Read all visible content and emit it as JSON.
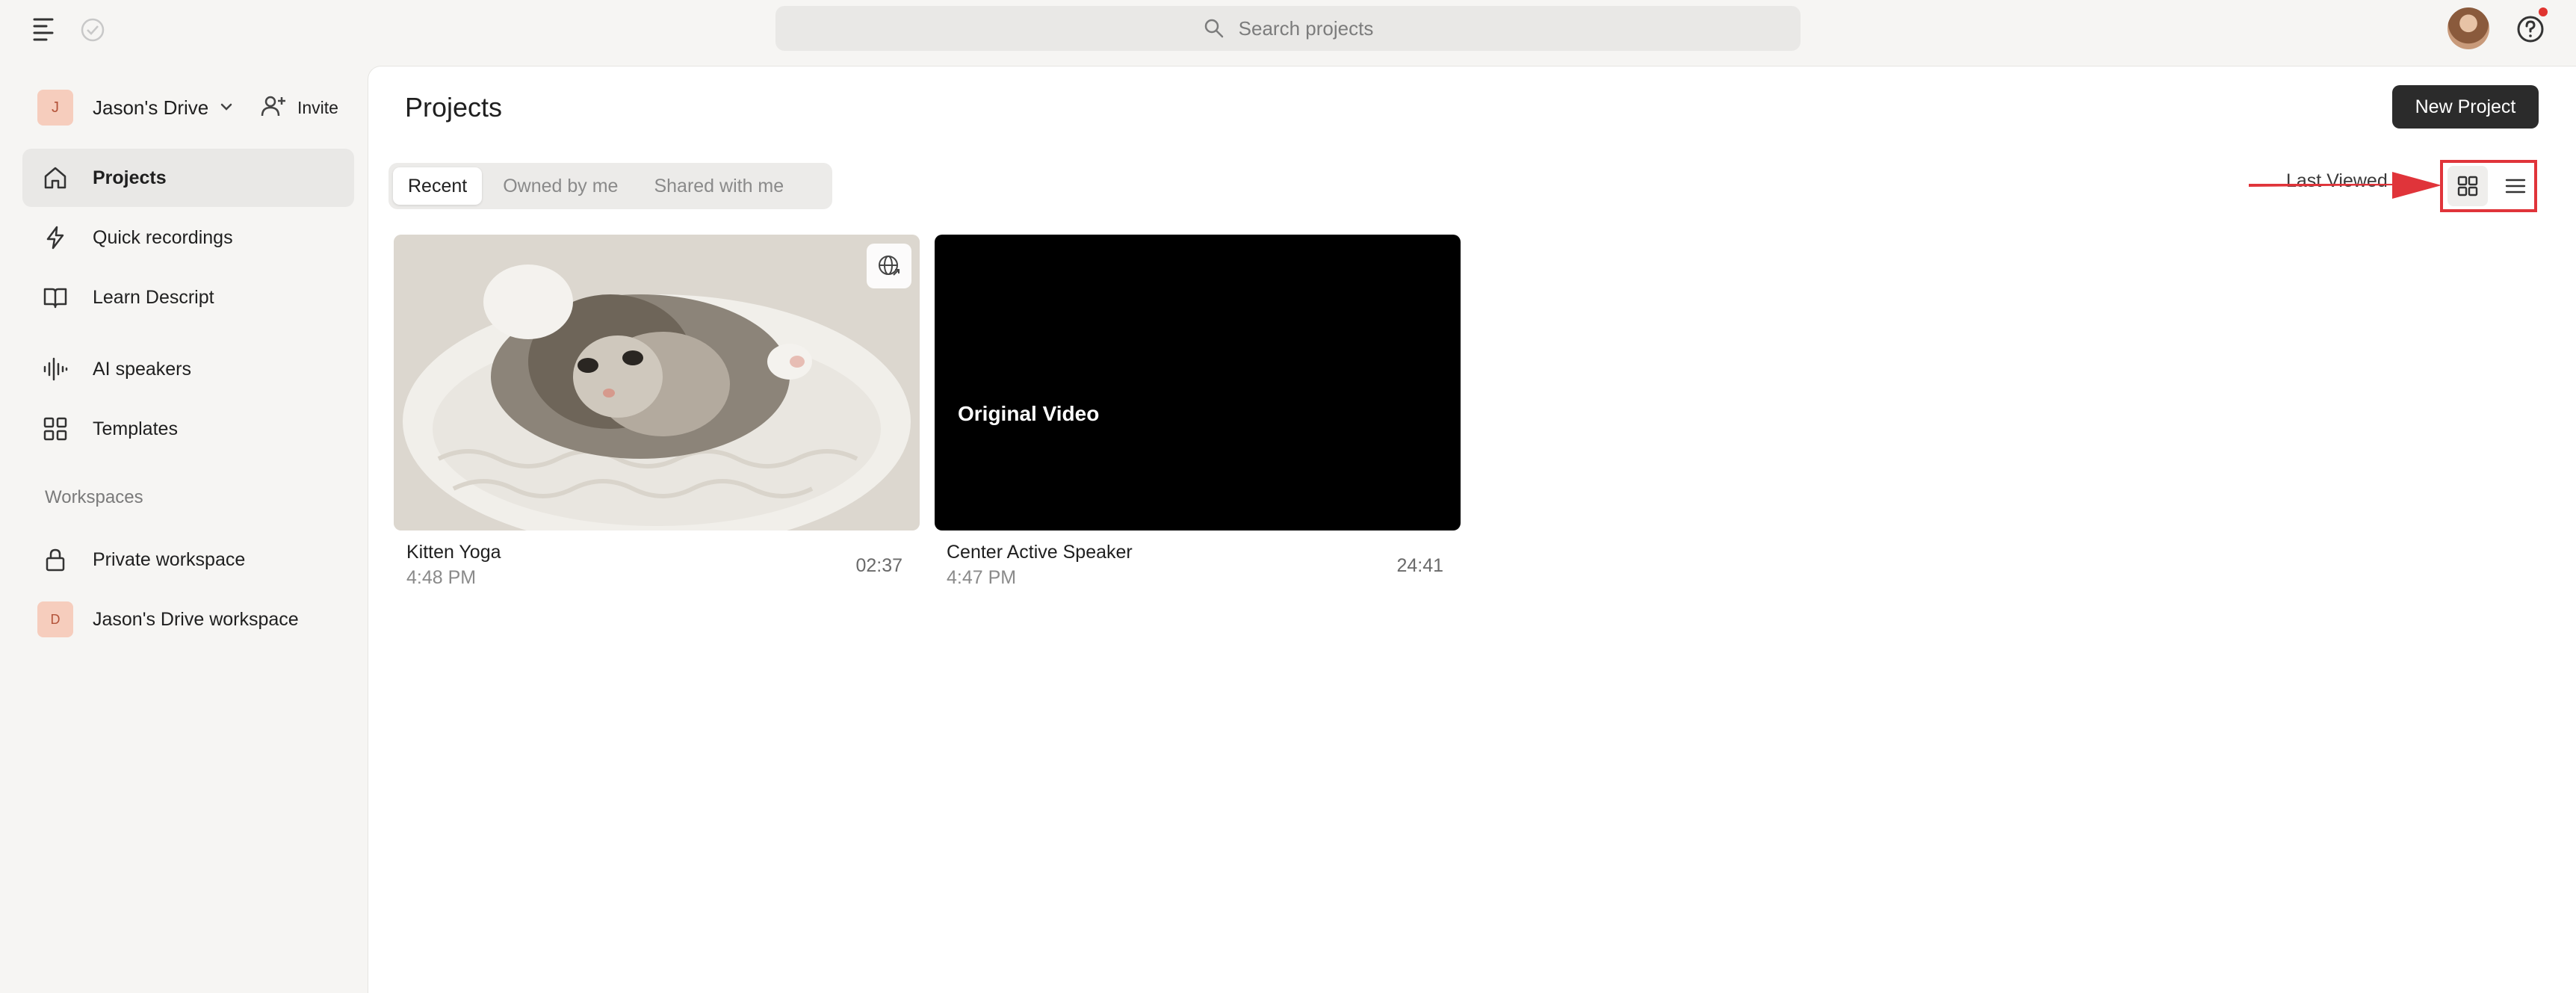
{
  "topbar": {
    "search_placeholder": "Search projects"
  },
  "sidebar": {
    "drive_initial": "J",
    "drive_name": "Jason's Drive",
    "invite_label": "Invite",
    "items": [
      {
        "label": "Projects",
        "icon": "home-icon",
        "active": true
      },
      {
        "label": "Quick recordings",
        "icon": "lightning-icon"
      },
      {
        "label": "Learn Descript",
        "icon": "book-icon"
      },
      {
        "label": "AI speakers",
        "icon": "waveform-icon"
      },
      {
        "label": "Templates",
        "icon": "grid-icon"
      }
    ],
    "workspaces_heading": "Workspaces",
    "workspaces": [
      {
        "label": "Private workspace",
        "icon": "lock-icon"
      },
      {
        "label": "Jason's Drive workspace",
        "badge": "D"
      }
    ]
  },
  "main": {
    "title": "Projects",
    "new_project_label": "New Project",
    "tabs": [
      {
        "label": "Recent",
        "active": true
      },
      {
        "label": "Owned by me"
      },
      {
        "label": "Shared with me"
      }
    ],
    "sort_label": "Last Viewed",
    "projects": [
      {
        "title": "Kitten Yoga",
        "time": "4:48 PM",
        "duration": "02:37",
        "thumbnail": "kitten-photo",
        "shared": true
      },
      {
        "title": "Center Active Speaker",
        "time": "4:47 PM",
        "duration": "24:41",
        "thumbnail_label": "Original Video"
      }
    ]
  },
  "colors": {
    "annotation_red": "#e0343a",
    "badge_bg": "#f6cdbd",
    "primary_button": "#2b2b2b"
  }
}
